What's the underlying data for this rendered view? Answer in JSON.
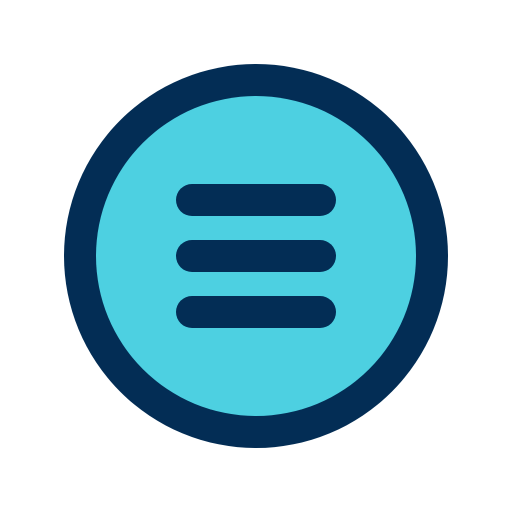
{
  "icon": {
    "name": "hamburger-menu-icon",
    "lines": 3,
    "colors": {
      "ring": "#032d55",
      "fill": "#4dd0e1",
      "bars": "#032d55",
      "background": "#ffffff"
    }
  }
}
